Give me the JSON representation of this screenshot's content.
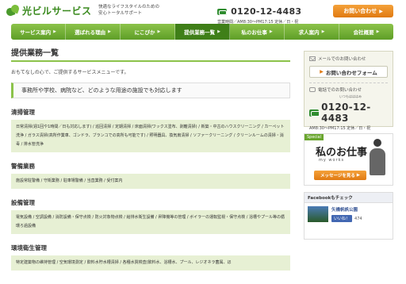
{
  "header": {
    "logo_text": "光ビルサービス",
    "tagline_line1": "快適なライフスタイルのための",
    "tagline_line2": "安心トータルサポート",
    "phone": "0120-12-4483",
    "phone_hours": "営業時間／AM8:30〜PM17:15 定休／日・祝",
    "contact_label": "お問い合わせ"
  },
  "nav": {
    "items": [
      {
        "label": "サービス案内"
      },
      {
        "label": "選ばれる理由"
      },
      {
        "label": "にこぴか"
      },
      {
        "label": "提供業務一覧"
      },
      {
        "label": "私のお仕事"
      },
      {
        "label": "求人案内"
      },
      {
        "label": "会社概要"
      }
    ]
  },
  "main": {
    "title": "提供業務一覧",
    "intro": "おもてなしの心で、ご提供するサービスメニューです。",
    "lead": "事務所や学校、病院など、どのような用途の施設でも対応します",
    "sections": [
      {
        "title": "清掃管理",
        "body": "日常清掃(週1回や1時間／日も対応します) / 巡回清掃 / 定期清掃 / 床面清掃(ワックス塗布、剥離清掃) / 新築・中古のハウスクリーニング / カーペット洗浄 / ガラス清掃(高所作業車、ゴンドラ、ブランコでの高所も可能です) / 照明器具、換気扇清掃 / ソファークリーニング / クリーンルームの清掃・消毒 / 排水管洗浄"
      },
      {
        "title": "警備業務",
        "body": "施設常駐警備 / 守衛業務 / 駐車場警備 / 当直業務 / 受付案内"
      },
      {
        "title": "設備管理",
        "body": "電気設備 / 空調設備 / 消防設備・保守点検 / 防火対象物点検 / 給排水衛生設備 / 昇降機等の管理 / ボイラーの運転監視・保守点検 / 浴槽やプール等の循環ろ過設備"
      },
      {
        "title": "環境衛生管理",
        "body": "特定建築物の維持管理 / 空気環境測定 / 飲料水貯水槽清掃 / 各種水質検査(飲料水、浴槽水、プール、レジオネラ菌属、ほ"
      }
    ]
  },
  "sidebar": {
    "mail_label": "メールでのお問い合わせ",
    "form_button": "お問い合わせフォーム",
    "phone_label": "電話でのお問い合わせ",
    "phone_ruby": "いつもはははみ",
    "phone": "0120-12-4483",
    "phone_hours": "AM8:30〜PM17:15 定休／日・祝",
    "special_tag": "Special",
    "special_title": "私のお仕事",
    "special_sub": "my works",
    "special_button": "メッセージを見る",
    "fb_header": "Facebookもチェック",
    "fb_page_name": "矢橋帆帆公園",
    "fb_like_label": "いいね！",
    "fb_like_count": "474"
  }
}
